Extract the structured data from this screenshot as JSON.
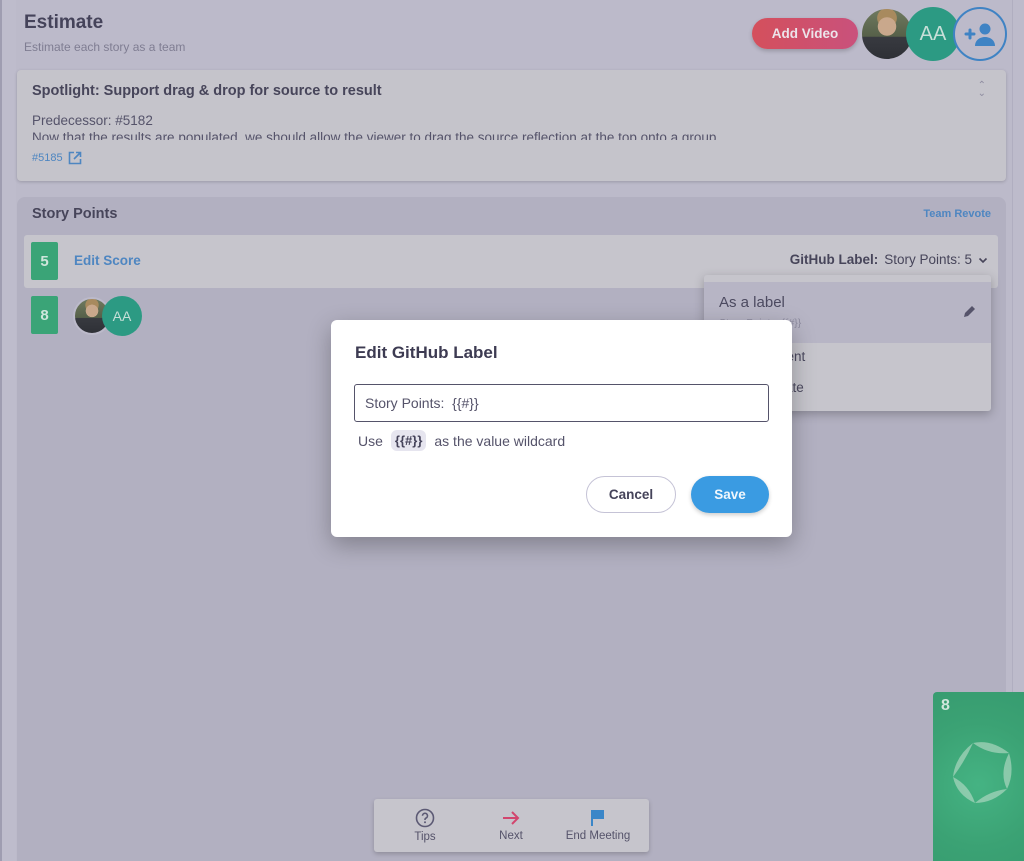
{
  "header": {
    "title": "Estimate",
    "subtitle": "Estimate each story as a team",
    "add_video_label": "Add Video",
    "participants": [
      {
        "type": "photo",
        "name": "user-photo"
      },
      {
        "type": "initials",
        "initials": "AA"
      }
    ],
    "add_user_icon": "person-add-icon"
  },
  "spotlight": {
    "title": "Spotlight: Support drag & drop for source to result",
    "predecessor": "Predecessor: #5182",
    "description": "Now that the results are populated, we should allow the viewer to drag the source reflection at the top onto a group",
    "issue_link": "#5185",
    "external_link_icon": "open-in-new-icon",
    "expand_icon": "unfold-icon"
  },
  "story_points": {
    "title": "Story Points",
    "team_revote_label": "Team Revote",
    "active_row": {
      "score": "5",
      "edit_score_label": "Edit Score",
      "github_label_prefix": "GitHub Label:",
      "github_label_value": "Story Points: 5"
    },
    "vote_rows": [
      {
        "score": "8",
        "voters": [
          "user-photo",
          "AA"
        ]
      }
    ]
  },
  "label_menu": {
    "items": [
      {
        "title": "As a label",
        "subtitle": "Story Points: {{#}}",
        "selected": true
      },
      {
        "title": "As a comment",
        "visible_fragment": "t"
      },
      {
        "title": "Do not update",
        "visible_fragment": "ate"
      }
    ]
  },
  "modal": {
    "title": "Edit GitHub Label",
    "input_value": "Story Points:  {{#}}",
    "hint_prefix": "Use",
    "hint_token": "{{#}}",
    "hint_suffix": "as the value wildcard",
    "cancel_label": "Cancel",
    "save_label": "Save"
  },
  "bottom_bar": {
    "tips_label": "Tips",
    "next_label": "Next",
    "end_meeting_label": "End Meeting"
  },
  "deck": {
    "card_value": "8"
  },
  "colors": {
    "primary_blue": "#3a9be2",
    "link_blue": "#4e86c1",
    "card_green": "#3aa477",
    "accent_red": "#d4505c",
    "next_arrow": "#d2466e"
  }
}
